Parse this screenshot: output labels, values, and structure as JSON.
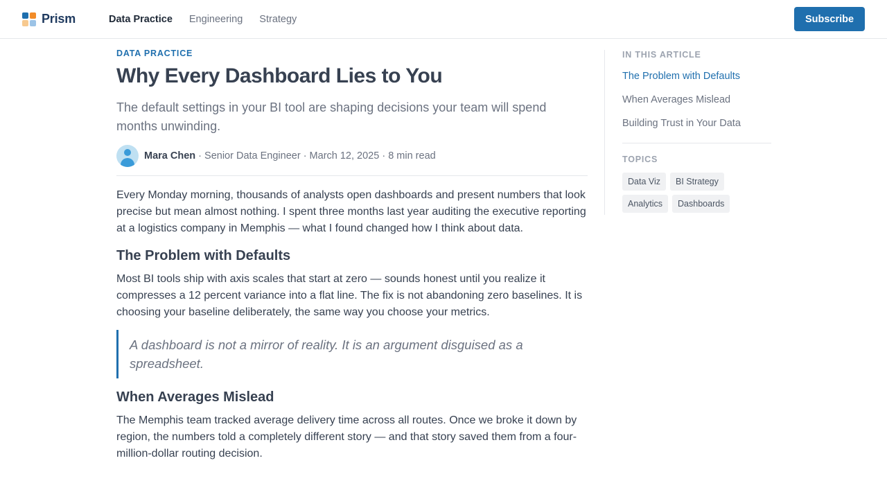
{
  "brand": {
    "name": "Prism",
    "logo_colors": [
      "#1f6fae",
      "#f28c28",
      "#f7c98f",
      "#9cc3e6"
    ]
  },
  "nav": {
    "items": [
      {
        "label": "Data Practice",
        "active": true
      },
      {
        "label": "Engineering",
        "active": false
      },
      {
        "label": "Strategy",
        "active": false
      }
    ]
  },
  "header": {
    "subscribe_label": "Subscribe"
  },
  "article": {
    "category": "DATA PRACTICE",
    "title": "Why Every Dashboard Lies to You",
    "dek": "The default settings in your BI tool are shaping decisions your team will spend months unwinding.",
    "author": "Mara Chen",
    "meta": " · Senior Data Engineer · March 12, 2025 · 8 min read",
    "intro": "Every Monday morning, thousands of analysts open dashboards and present numbers that look precise but mean almost nothing. I spent three months last year auditing the executive reporting at a logistics company in Memphis — what I found changed how I think about data.",
    "section1_heading": "The Problem with Defaults",
    "section1_body": "Most BI tools ship with axis scales that start at zero — sounds honest until you realize it compresses a 12 percent variance into a flat line. The fix is not abandoning zero baselines. It is choosing your baseline deliberately, the same way you choose your metrics.",
    "pullquote": "A dashboard is not a mirror of reality. It is an argument disguised as a spreadsheet.",
    "section2_heading": "When Averages Mislead",
    "section2_body": "The Memphis team tracked average delivery time across all routes. Once we broke it down by region, the numbers told a completely different story — and that story saved them from a four-million-dollar routing decision."
  },
  "sidebar": {
    "toc_label": "IN THIS ARTICLE",
    "toc": [
      {
        "label": "The Problem with Defaults",
        "active": true
      },
      {
        "label": "When Averages Mislead",
        "active": false
      },
      {
        "label": "Building Trust in Your Data",
        "active": false
      }
    ],
    "topics_label": "TOPICS",
    "topics": [
      "Data Viz",
      "BI Strategy",
      "Analytics",
      "Dashboards"
    ]
  },
  "colors": {
    "accent": "#1f6fae",
    "text": "#374151",
    "muted": "#6b7280"
  }
}
